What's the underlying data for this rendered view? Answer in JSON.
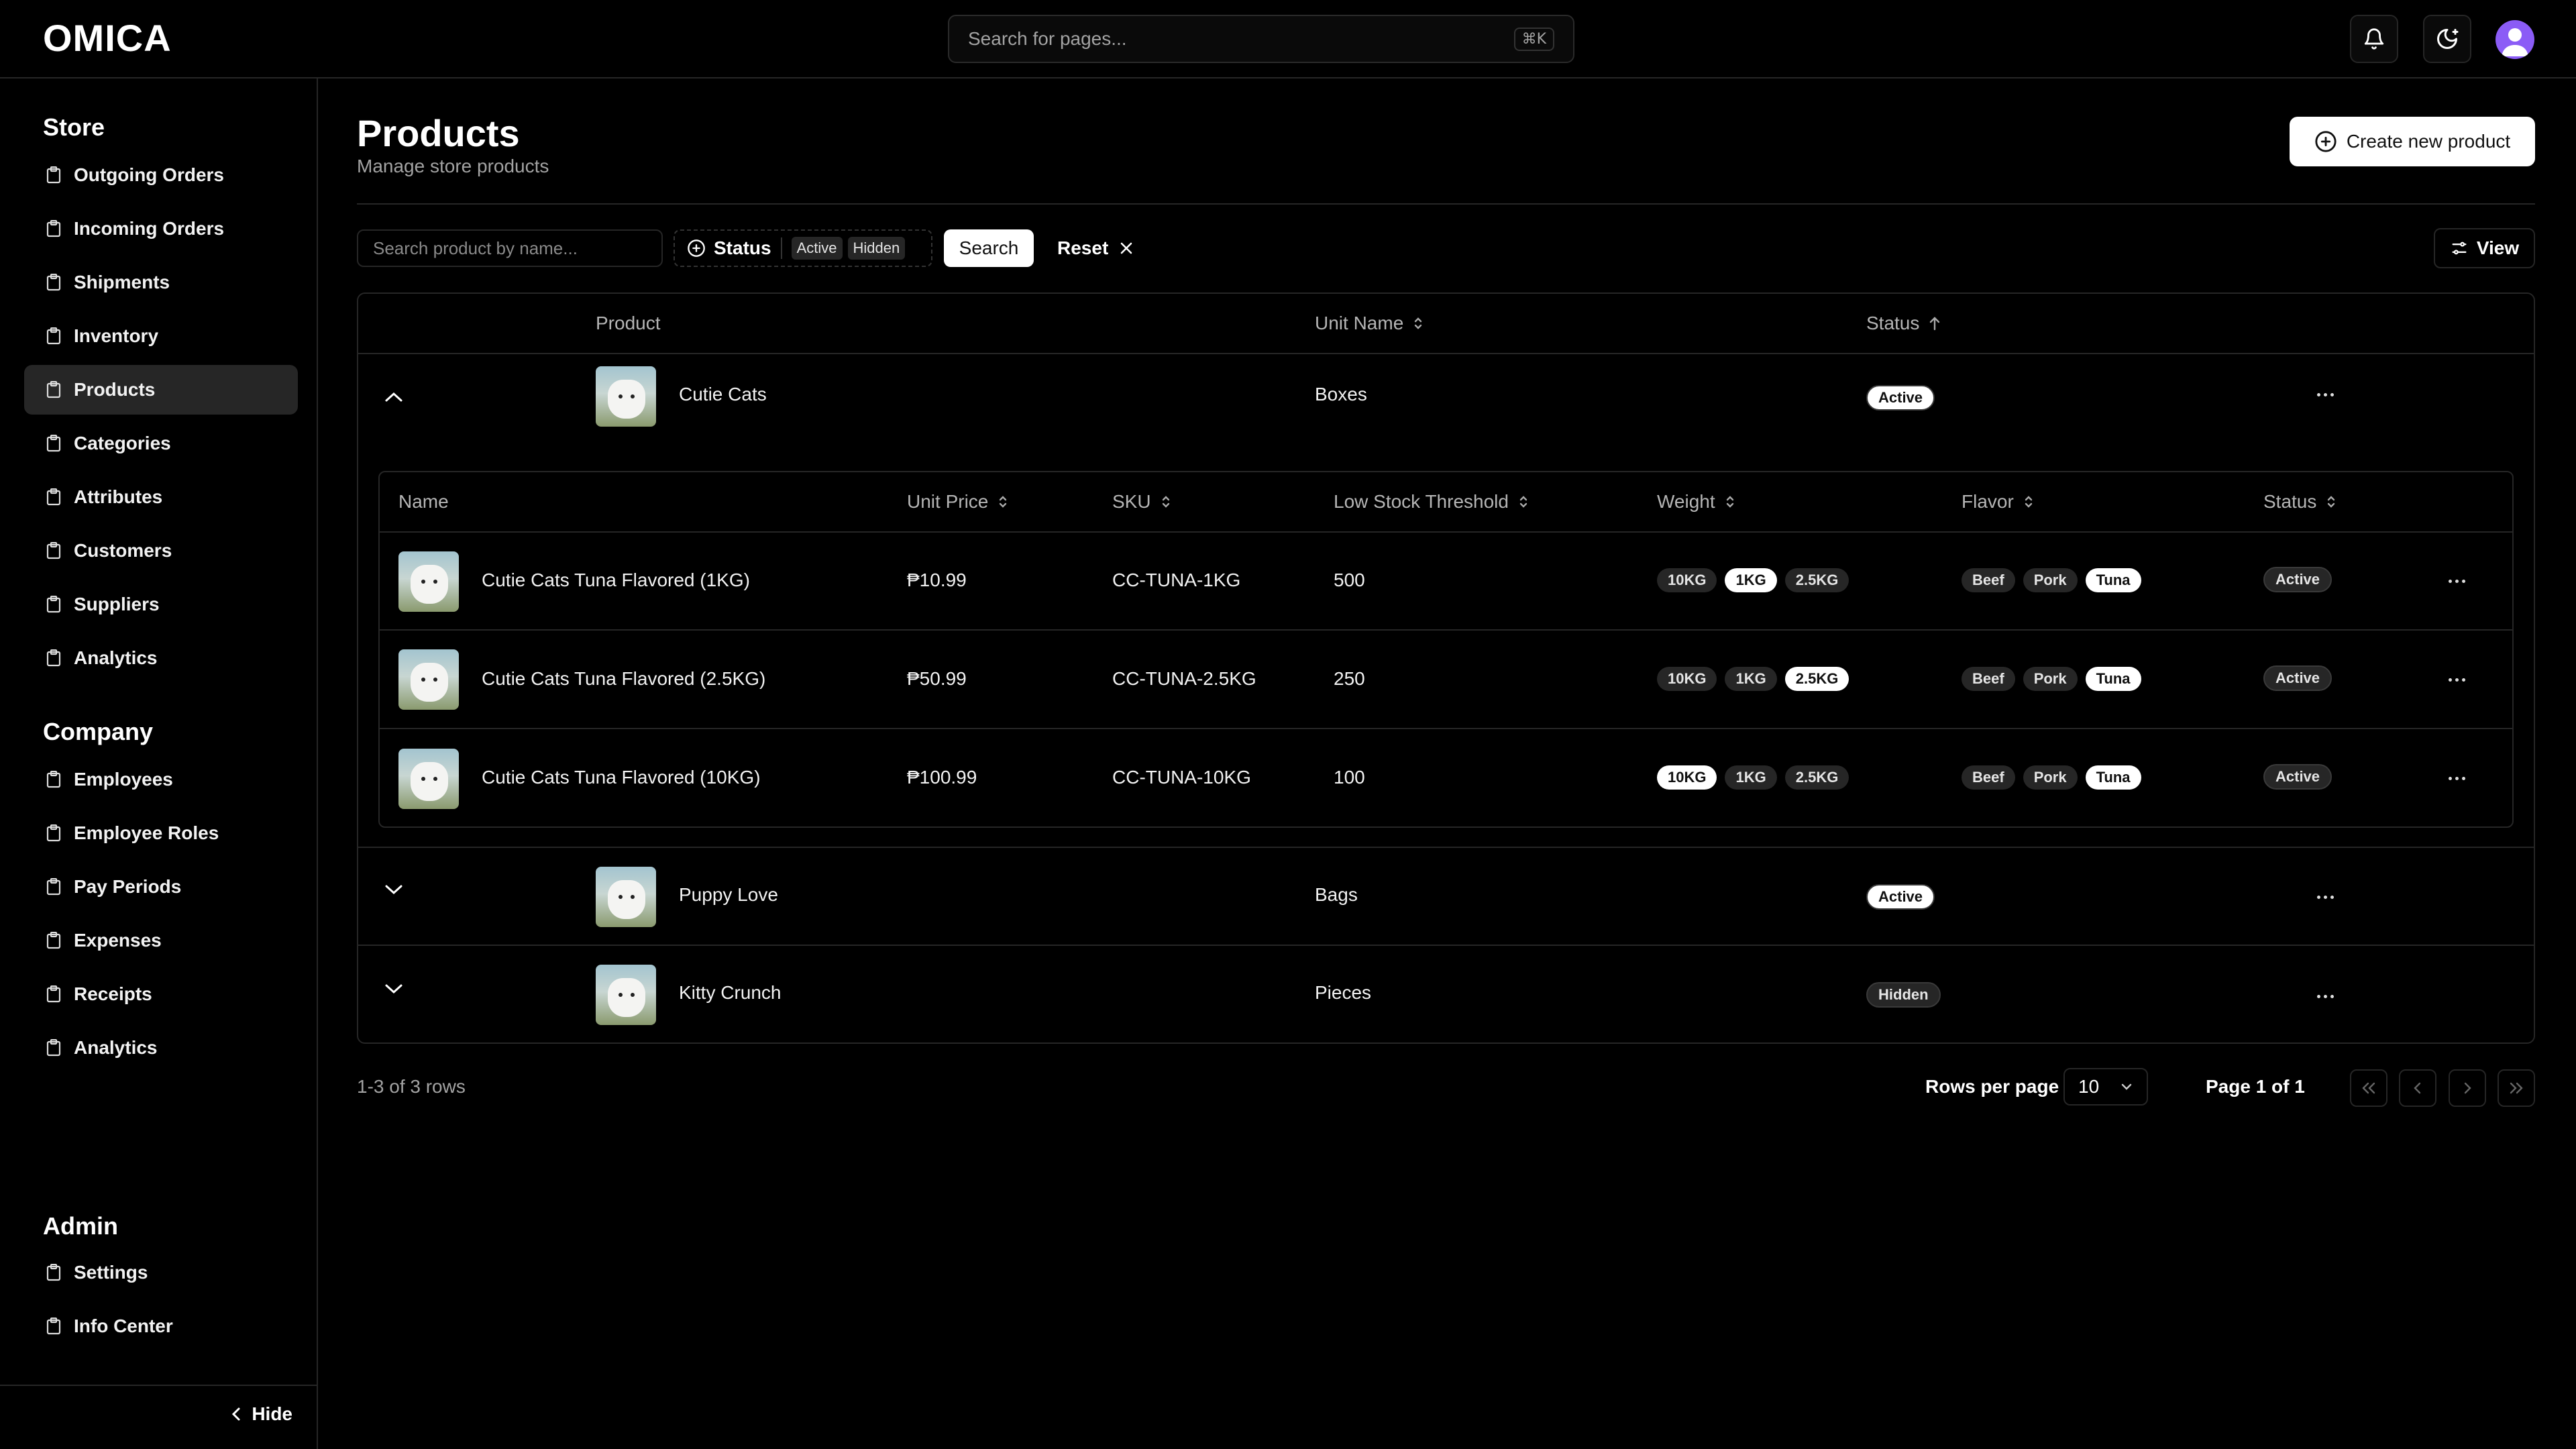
{
  "app": {
    "logo": "OMICA"
  },
  "topbar": {
    "search_placeholder": "Search for pages...",
    "search_shortcut": "⌘K"
  },
  "sidebar": {
    "store_title": "Store",
    "store_items": [
      "Outgoing Orders",
      "Incoming Orders",
      "Shipments",
      "Inventory",
      "Products",
      "Categories",
      "Attributes",
      "Customers",
      "Suppliers",
      "Analytics"
    ],
    "company_title": "Company",
    "company_items": [
      "Employees",
      "Employee Roles",
      "Pay Periods",
      "Expenses",
      "Receipts",
      "Analytics"
    ],
    "admin_title": "Admin",
    "admin_items": [
      "Settings",
      "Info Center"
    ],
    "hide_label": "Hide",
    "active_item": "Products"
  },
  "header": {
    "title": "Products",
    "subtitle": "Manage store products",
    "create_label": "Create new product"
  },
  "filters": {
    "search_placeholder": "Search product by name...",
    "status_label": "Status",
    "status_values": [
      "Active",
      "Hidden"
    ],
    "search_button": "Search",
    "reset_button": "Reset",
    "view_button": "View"
  },
  "table": {
    "columns": [
      "Product",
      "Unit Name",
      "Status"
    ],
    "rows": [
      {
        "product": "Cutie Cats",
        "unit": "Boxes",
        "status": "Active",
        "expanded": true
      },
      {
        "product": "Puppy Love",
        "unit": "Bags",
        "status": "Active",
        "expanded": false
      },
      {
        "product": "Kitty Crunch",
        "unit": "Pieces",
        "status": "Hidden",
        "expanded": false
      }
    ],
    "variants": {
      "columns": [
        "Name",
        "Unit Price",
        "SKU",
        "Low Stock Threshold",
        "Weight",
        "Flavor",
        "Status"
      ],
      "weights": [
        "10KG",
        "1KG",
        "2.5KG"
      ],
      "flavors": [
        "Beef",
        "Pork",
        "Tuna"
      ],
      "rows": [
        {
          "name": "Cutie Cats Tuna Flavored (1KG)",
          "price": "₱10.99",
          "sku": "CC-TUNA-1KG",
          "threshold": "500",
          "weight_selected": "1KG",
          "flavor_selected": "Tuna",
          "status": "Active"
        },
        {
          "name": "Cutie Cats Tuna Flavored (2.5KG)",
          "price": "₱50.99",
          "sku": "CC-TUNA-2.5KG",
          "threshold": "250",
          "weight_selected": "2.5KG",
          "flavor_selected": "Tuna",
          "status": "Active"
        },
        {
          "name": "Cutie Cats Tuna Flavored (10KG)",
          "price": "₱100.99",
          "sku": "CC-TUNA-10KG",
          "threshold": "100",
          "weight_selected": "10KG",
          "flavor_selected": "Tuna",
          "status": "Active"
        }
      ]
    }
  },
  "footer": {
    "rows_count": "1-3 of 3 rows",
    "rows_per_page_label": "Rows per page",
    "rows_per_page_value": "10",
    "page_label": "Page 1 of 1"
  },
  "colors": {
    "background": "#000000",
    "border": "#262626",
    "accent_avatar": "#8b5cf6",
    "active_bg": "#262626"
  },
  "icons": [
    "bell-icon",
    "theme-toggle-icon",
    "clipboard-icon",
    "plus-circle-icon",
    "sort-icon",
    "sort-asc-icon",
    "chevron-up-icon",
    "chevron-down-icon",
    "more-horizontal-icon",
    "sliders-icon",
    "close-icon",
    "chevron-left-icon",
    "chevrons-left-icon",
    "chevron-right-icon",
    "chevrons-right-icon"
  ]
}
